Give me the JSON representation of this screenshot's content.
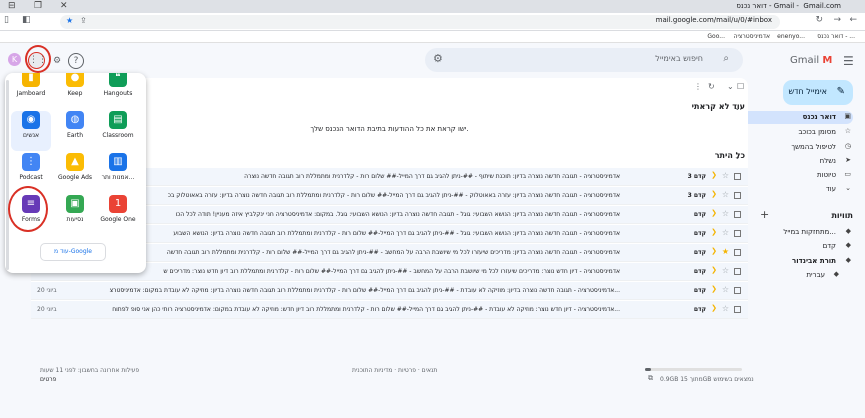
{
  "browser": {
    "tab_title": "דואר נכנס - Gmail - ‎ Gmail.com",
    "url": "mail.google.com/mail/u/0/#inbox",
    "bookmarks": [
      "דואר נכנס - ...",
      "enenyo...",
      "אדמיניסטרציה",
      "Goo..."
    ]
  },
  "header": {
    "logo": "Gmail",
    "search_placeholder": "חיפוש באימייל",
    "avatar_letter": "K"
  },
  "compose_label": "אימייל חדש",
  "sidebar": {
    "items": [
      {
        "label": "דואר נכנס",
        "icon": "inbox-icon",
        "glyph": "▣"
      },
      {
        "label": "מסומן בכוכב",
        "icon": "star-icon",
        "glyph": "☆"
      },
      {
        "label": "לטיפול בהמשך",
        "icon": "clock-icon",
        "glyph": "◷"
      },
      {
        "label": "נשלח",
        "icon": "send-icon",
        "glyph": "➤"
      },
      {
        "label": "טיוטות",
        "icon": "draft-icon",
        "glyph": "▭"
      },
      {
        "label": "עוד",
        "icon": "chevron-down-icon",
        "glyph": "⌄"
      }
    ],
    "labels_title": "תוויות",
    "labels": [
      {
        "label": "מתחזקות במייל...",
        "count": ""
      },
      {
        "label": "קדם",
        "count": ""
      },
      {
        "label": "תורת אבינדור",
        "count": "1"
      },
      {
        "label": "עברית",
        "count": ""
      }
    ]
  },
  "main": {
    "unread_title": "עוד לא קראתי",
    "unread_empty": "ישו קראת את כל ההודעות בתיבת הדואר הנכנס שלך.",
    "all_title": "כל היתר",
    "rows": [
      {
        "sender": "קדם 3",
        "text": "אדמיניסטרציה - תגובה חדשה נוצרה בדיון: תוכנת שיתוף - ##-ניתן להגיב גם דרך המייל-## שלום רות - קלדרנית ומתמללת רוב תגובה חדשה נוצרה",
        "time": "",
        "starred": false
      },
      {
        "sender": "קדם 3",
        "text": "אדמיניסטרציה - תגובה חדשה נוצרה בדיון: עזרה באאוטלוק - ##-ניתן להגיב גם דרך המייל-## שלום רות - קלדרנית ומתמללת רוב תגובה חדשה נוצרה בדיון: עזרה באאוטלוק בכ",
        "time": "",
        "starred": false
      },
      {
        "sender": "קדם",
        "text": "אדמיניסטרציה - תגובה חדשה נוצרה בדיון: הנושא השבועי: גוגל - תגובה חדשה נוצרה בדיון: הנושא השבועי: גוגל. במקום: אדמיניסטרציה חני ינקלביץ איזה מעניין! תודה לכל הכו",
        "time": "",
        "starred": false
      },
      {
        "sender": "קדם",
        "text": "אדמיניסטרציה - תגובה חדשה נוצרה בדיון: הנושא השבועי: גוגל - ##-ניתן להגיב גם דרך המייל-## שלום רות - קלדרנית ומתמללת רוב תגובה חדשה נוצרה בדיון: הנושא השבוע",
        "time": "",
        "starred": false
      },
      {
        "sender": "קדם",
        "text": "אדמיניסטרציה - תגובה חדשה נוצרה בדיון: מדריכים שיעזרו לכל מי שיושבת הרבה על המחשב - ##-ניתן להגיב גם דרך המייל-## שלום רות - קלדרנית ומתמללת רוב תגובה חדשה",
        "time": "",
        "starred": true
      },
      {
        "sender": "קדם",
        "text": "אדמיניסטרציה - דיון חדש נוצר: מדריכים שיעזרו לכל מי שיושבת הרבה על המחשב - ##-ניתן להגיב גם דרך המייל-## שלום רות - קלדרנית ומתמללת רוב דיון חדש נוצר: מדריכים ש",
        "time": "",
        "starred": false
      },
      {
        "sender": "קדם",
        "text": "אדמיניסטרציה - תגובה חדשה נוצרה בדיון: מוזיקה לא עובדת - ##-ניתן להגיב גם דרך המייל-## שלום רות - קלדרנית ומתמללת רוב תגובה חדשה נוצרה בדיון: מוזיקה לא עובדת במקום: אדמיניסטרצ...",
        "time": "20 ביוני",
        "starred": false
      },
      {
        "sender": "קדם",
        "text": "אדמיניסטרציה - דיון חדש נוצר: מוזיקה לא עובדת - ##-ניתן להגיב גם דרך המייל-## שלום רות - קלדרנית ומתמללת רוב דיון חדש: מוזיקה לא עובדת במקום: אדמיניסטרציה רותי כהן אני סופ לפתוח...",
        "time": "20 ביוני",
        "starred": false
      }
    ]
  },
  "footer": {
    "storage": "0.9GB מתוך 15GB נמצאים בשימוש",
    "storage_fraction": 0.06,
    "links": "תנאים · פרטיות · מדיניות התוכנית",
    "activity_line1": "פעילות אחרונה בחשבון: לפני 11 שעות",
    "activity_line2": "פרטים"
  },
  "apps_popup": {
    "apps": [
      {
        "label": "Jamboard",
        "icon": "jamboard-icon",
        "glyph": "▮",
        "color": "#f6b400"
      },
      {
        "label": "Keep",
        "icon": "keep-icon",
        "glyph": "●",
        "color": "#fbbc04"
      },
      {
        "label": "Hangouts",
        "icon": "hangouts-icon",
        "glyph": "❝",
        "color": "#0f9d58"
      },
      {
        "label": "אנשים",
        "icon": "contacts-icon",
        "glyph": "◉",
        "color": "#1a73e8"
      },
      {
        "label": "Earth",
        "icon": "earth-icon",
        "glyph": "◍",
        "color": "#4285f4"
      },
      {
        "label": "Classroom",
        "icon": "classroom-icon",
        "glyph": "▤",
        "color": "#0f9d58"
      },
      {
        "label": "Podcast",
        "icon": "podcast-icon",
        "glyph": "⋮",
        "color": "#4285f4"
      },
      {
        "label": "Google Ads",
        "icon": "ads-icon",
        "glyph": "▲",
        "color": "#fbbc04"
      },
      {
        "label": "אמנות ותר...",
        "icon": "arts-icon",
        "glyph": "▥",
        "color": "#1a73e8"
      },
      {
        "label": "Forms",
        "icon": "forms-icon",
        "glyph": "≡",
        "color": "#673ab7"
      },
      {
        "label": "נסיעות",
        "icon": "travel-icon",
        "glyph": "▣",
        "color": "#34a853"
      },
      {
        "label": "Google One",
        "icon": "google-one-icon",
        "glyph": "1",
        "color": "#ea4335"
      }
    ],
    "more_label": "עוד מ-Google"
  }
}
